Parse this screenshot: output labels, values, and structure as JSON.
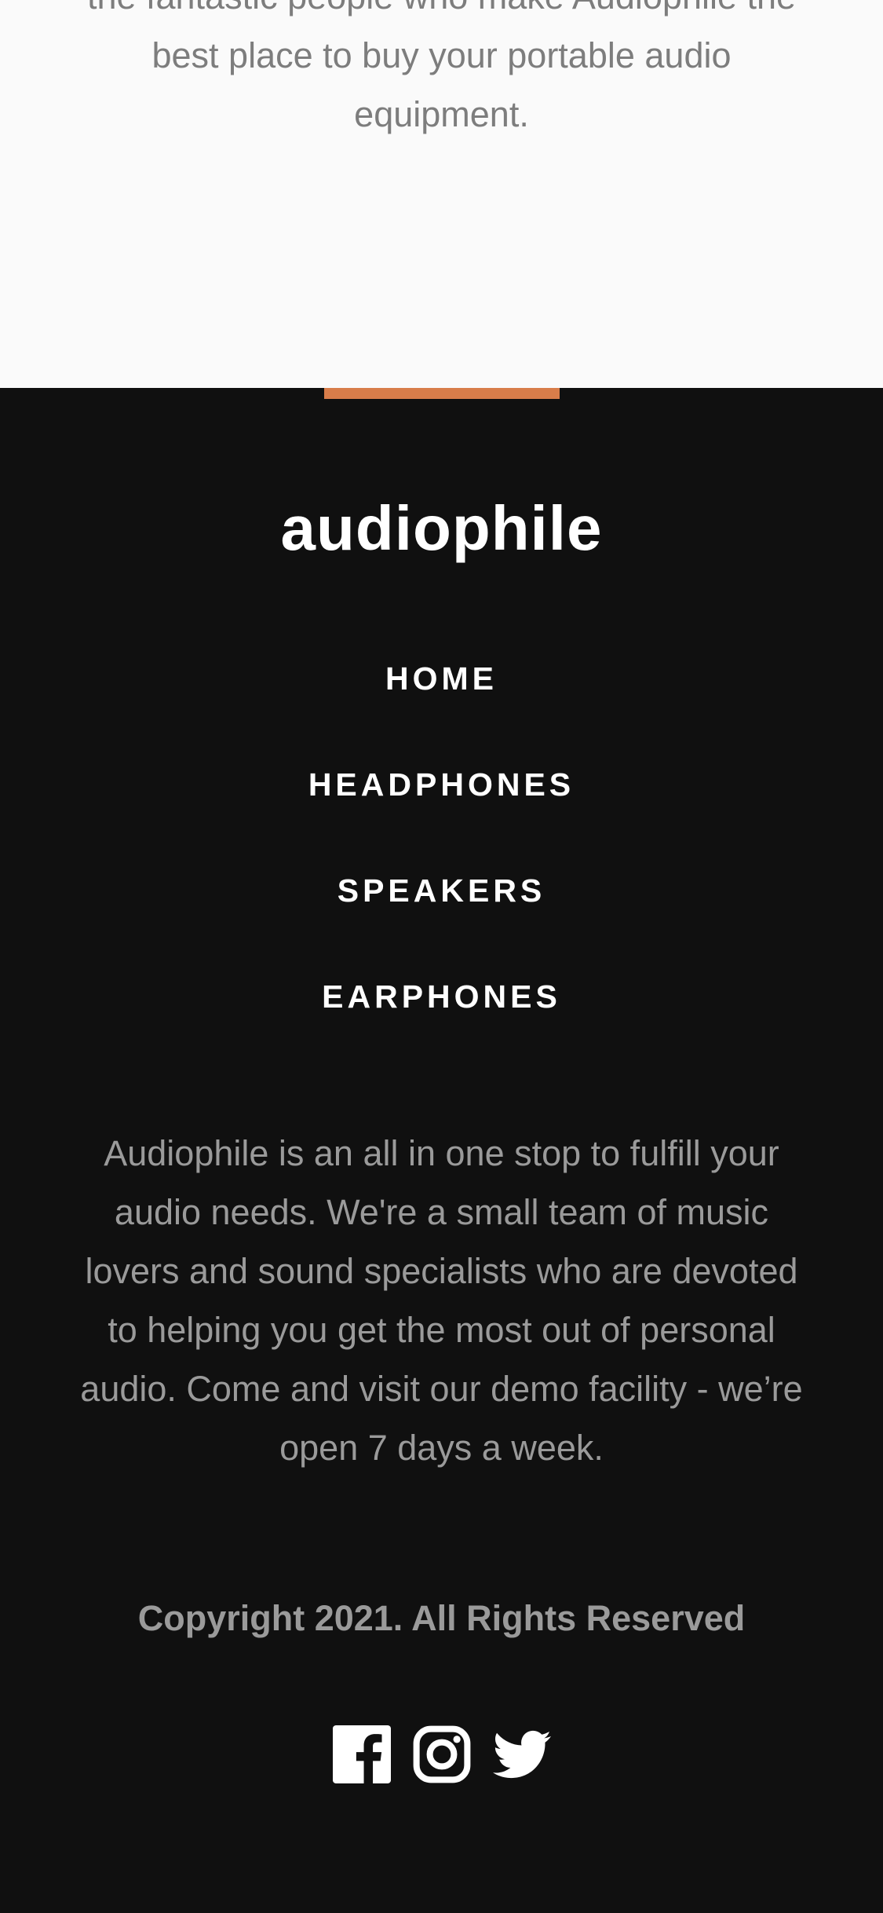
{
  "about": {
    "text_lines": [
      "the fantastic people who make Audiophile the",
      "best place to buy your portable audio",
      "equipment."
    ]
  },
  "footer": {
    "accent_color": "#D87D4A",
    "logo": "audiophile",
    "nav": [
      {
        "label": "HOME"
      },
      {
        "label": "HEADPHONES"
      },
      {
        "label": "SPEAKERS"
      },
      {
        "label": "EARPHONES"
      }
    ],
    "description_lines": [
      "Audiophile is an all in one stop to fulfill your",
      "audio needs. We're a small team of music",
      "lovers and sound specialists who are devoted",
      "to helping you get the most out of personal",
      "audio. Come and visit our demo facility - we’re",
      "open 7 days a week."
    ],
    "copyright": "Copyright 2021. All Rights Reserved",
    "social_icons": [
      "facebook-icon",
      "instagram-icon",
      "twitter-icon"
    ]
  }
}
